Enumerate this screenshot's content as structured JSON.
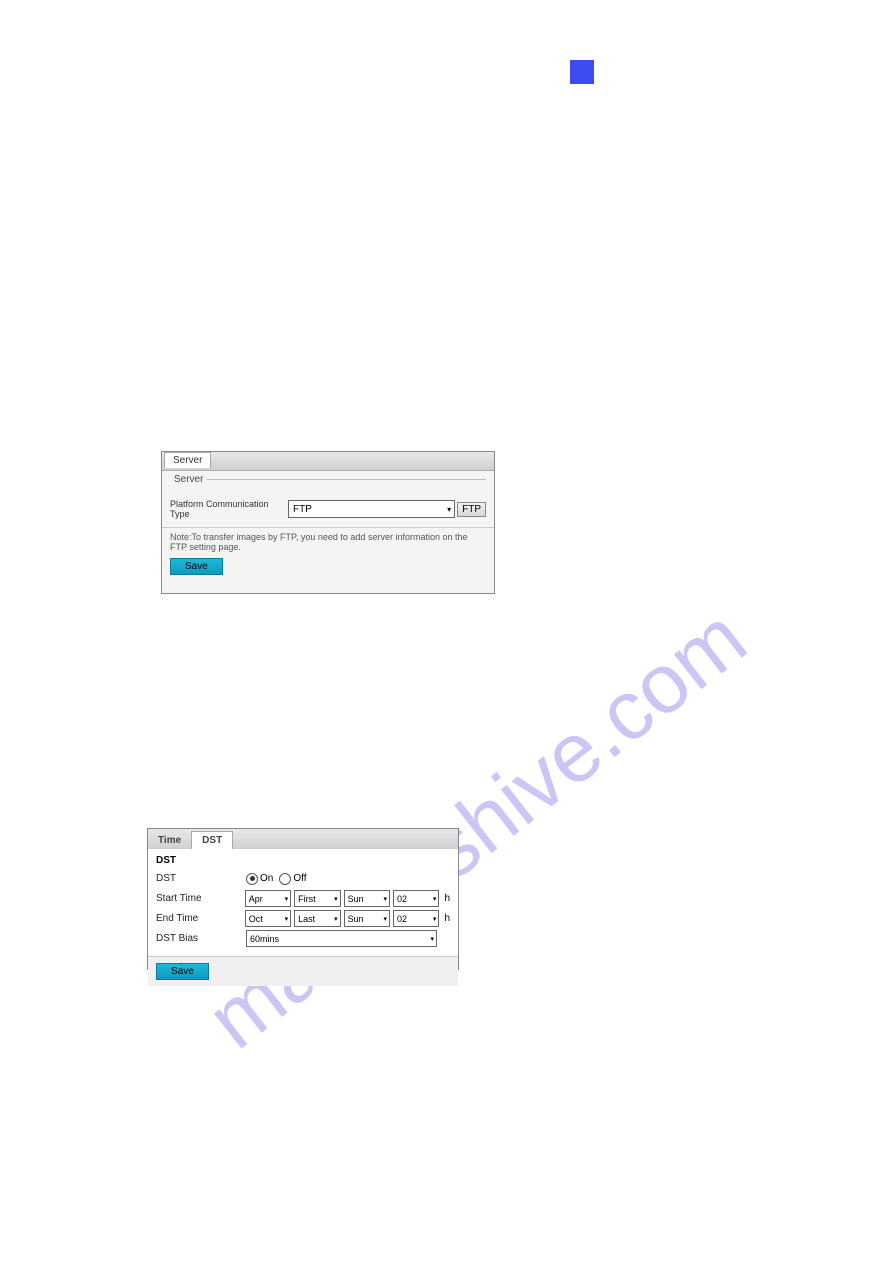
{
  "blue_box": "",
  "watermark_text": "manualshive.com",
  "shot1": {
    "tab_label": "Server",
    "group_title": "Server",
    "field_label": "Platform Communication Type",
    "select_value": "FTP",
    "ftp_button": "FTP",
    "note": "Note:To transfer images by FTP, you need to add server information on the FTP setting page.",
    "save_label": "Save"
  },
  "shot2": {
    "tab_time": "Time",
    "tab_dst": "DST",
    "section_title": "DST",
    "rows": {
      "dst_label": "DST",
      "on_label": "On",
      "off_label": "Off",
      "start_label": "Start Time",
      "start_month": "Apr",
      "start_week": "First",
      "start_day": "Sun",
      "start_hour": "02",
      "end_label": "End Time",
      "end_month": "Oct",
      "end_week": "Last",
      "end_day": "Sun",
      "end_hour": "02",
      "bias_label": "DST Bias",
      "bias_value": "60mins",
      "hour_unit": "h"
    },
    "save_label": "Save"
  }
}
